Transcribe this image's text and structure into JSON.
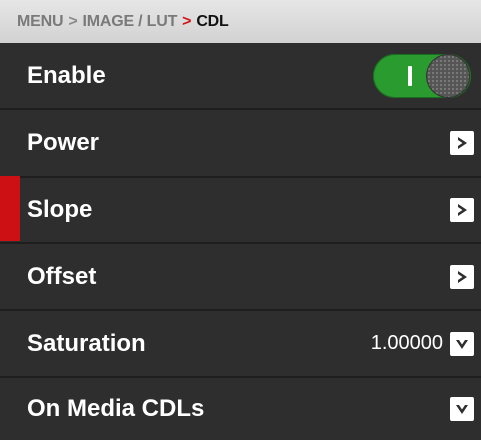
{
  "breadcrumb": {
    "items": [
      "MENU",
      "IMAGE / LUT",
      "CDL"
    ],
    "separator": ">"
  },
  "rows": [
    {
      "label": "Enable",
      "control": "toggle",
      "toggle_on": true
    },
    {
      "label": "Power",
      "control": "arrow-right"
    },
    {
      "label": "Slope",
      "control": "arrow-right",
      "selected": true
    },
    {
      "label": "Offset",
      "control": "arrow-right"
    },
    {
      "label": "Saturation",
      "control": "arrow-down",
      "value": "1.00000"
    },
    {
      "label": "On Media CDLs",
      "control": "arrow-down"
    }
  ],
  "colors": {
    "accent_red": "#cc1014",
    "toggle_green": "#2a9b2e",
    "background": "#2e2e2e"
  }
}
